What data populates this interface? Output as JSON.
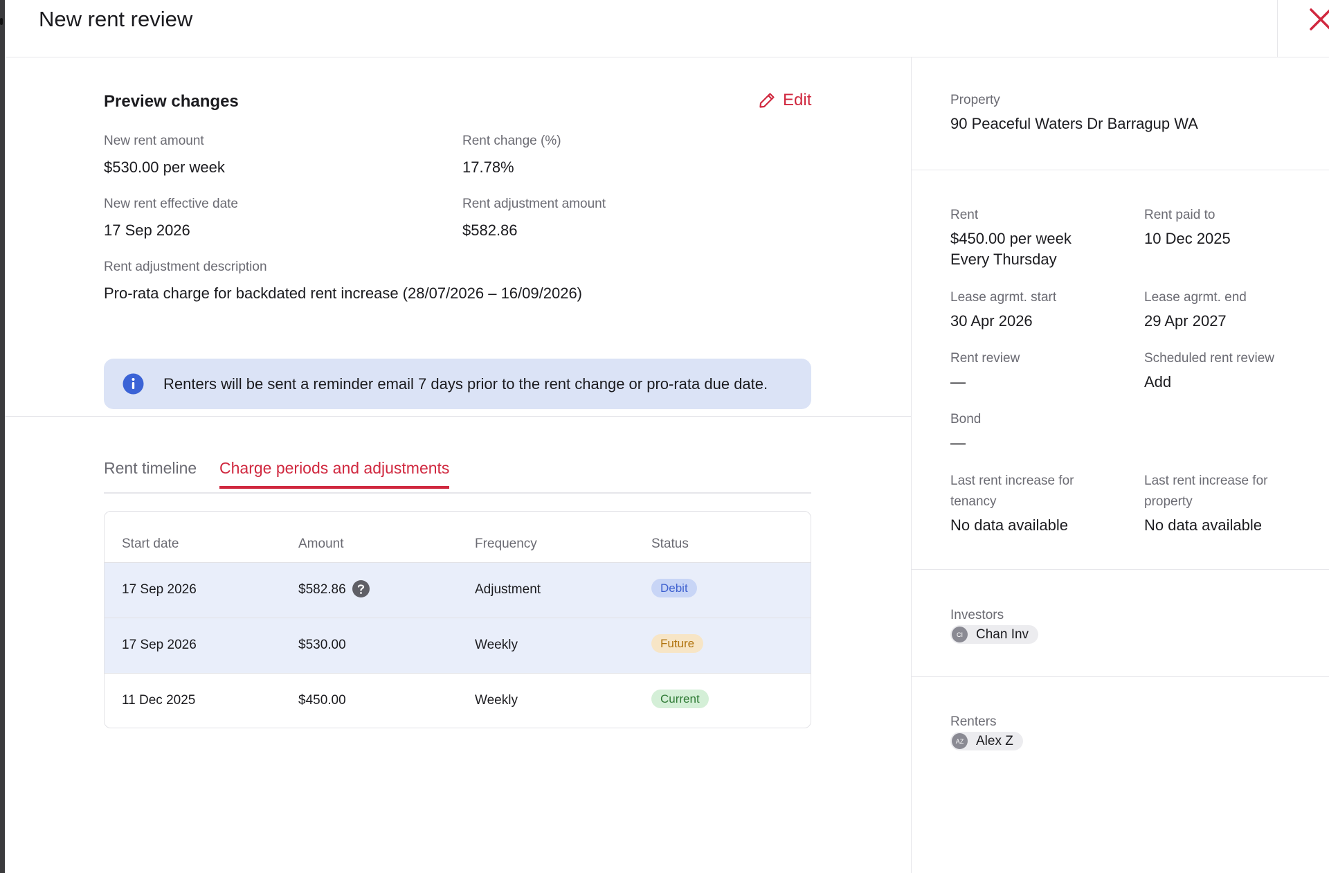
{
  "header": {
    "title": "New rent review"
  },
  "preview": {
    "title": "Preview changes",
    "edit_label": "Edit",
    "fields": {
      "new_rent_amount": {
        "label": "New rent amount",
        "value": "$530.00 per week"
      },
      "rent_change": {
        "label": "Rent change (%)",
        "value": "17.78%"
      },
      "effective_date": {
        "label": "New rent effective date",
        "value": "17 Sep 2026"
      },
      "adjustment_amount": {
        "label": "Rent adjustment amount",
        "value": "$582.86"
      },
      "adjustment_description": {
        "label": "Rent adjustment description",
        "value": "Pro-rata charge for backdated rent increase (28/07/2026 – 16/09/2026)"
      }
    },
    "info": "Renters will be sent a reminder email 7 days prior to the rent change or pro-rata due date."
  },
  "tabs": [
    {
      "label": "Rent timeline",
      "active": false
    },
    {
      "label": "Charge periods and adjustments",
      "active": true
    }
  ],
  "table": {
    "headers": [
      "Start date",
      "Amount",
      "Frequency",
      "Status"
    ],
    "rows": [
      {
        "start_date": "17 Sep 2026",
        "amount": "$582.86",
        "frequency": "Adjustment",
        "status": "Debit"
      },
      {
        "start_date": "17 Sep 2026",
        "amount": "$530.00",
        "frequency": "Weekly",
        "status": "Future"
      },
      {
        "start_date": "11 Dec 2025",
        "amount": "$450.00",
        "frequency": "Weekly",
        "status": "Current"
      }
    ]
  },
  "sidebar": {
    "property": {
      "label": "Property",
      "value": "90 Peaceful Waters Dr Barragup WA"
    },
    "rent": {
      "label": "Rent",
      "value_line1": "$450.00 per week",
      "value_line2": "Every Thursday"
    },
    "rent_paid_to": {
      "label": "Rent paid to",
      "value": "10 Dec 2025"
    },
    "lease_start": {
      "label": "Lease agrmt. start",
      "value": "30 Apr 2026"
    },
    "lease_end": {
      "label": "Lease agrmt. end",
      "value": "29 Apr 2027"
    },
    "rent_review": {
      "label": "Rent review",
      "value": "—"
    },
    "scheduled_review": {
      "label": "Scheduled rent review",
      "value": "Add"
    },
    "bond": {
      "label": "Bond",
      "value": "—"
    },
    "last_increase_tenancy": {
      "label_line1": "Last rent increase for",
      "label_line2": "tenancy",
      "value": "No data available"
    },
    "last_increase_property": {
      "label_line1": "Last rent increase for",
      "label_line2": "property",
      "value": "No data available"
    },
    "investors": {
      "label": "Investors",
      "initials": "CI",
      "name": "Chan Inv"
    },
    "renters": {
      "label": "Renters",
      "initials": "AZ",
      "name": "Alex Z"
    }
  },
  "colors": {
    "accent": "#d0283f",
    "info_bg": "#dbe3f6",
    "info_icon": "#3b63d6"
  }
}
